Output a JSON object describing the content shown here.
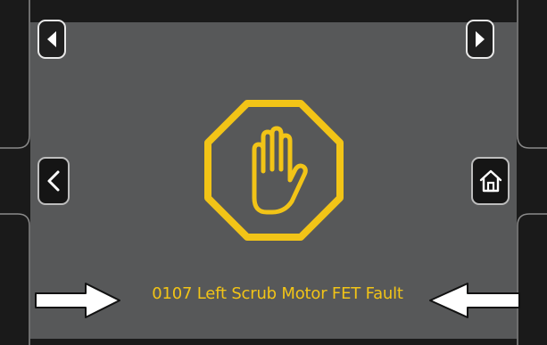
{
  "fault": {
    "message": "0107 Left Scrub Motor FET Fault",
    "color": "#f2c417"
  },
  "navigation": {
    "prev_icon": "left-triangle-icon",
    "next_icon": "right-triangle-icon",
    "back_icon": "chevron-left-icon",
    "home_icon": "home-icon"
  },
  "icons": {
    "fault_icon": "stop-hand-octagon-icon",
    "left_arrow": "arrow-right-callout",
    "right_arrow": "arrow-left-callout"
  },
  "colors": {
    "screen_bg": "#575859",
    "bezel": "#1a1a1a",
    "accent_yellow": "#f2c417"
  }
}
